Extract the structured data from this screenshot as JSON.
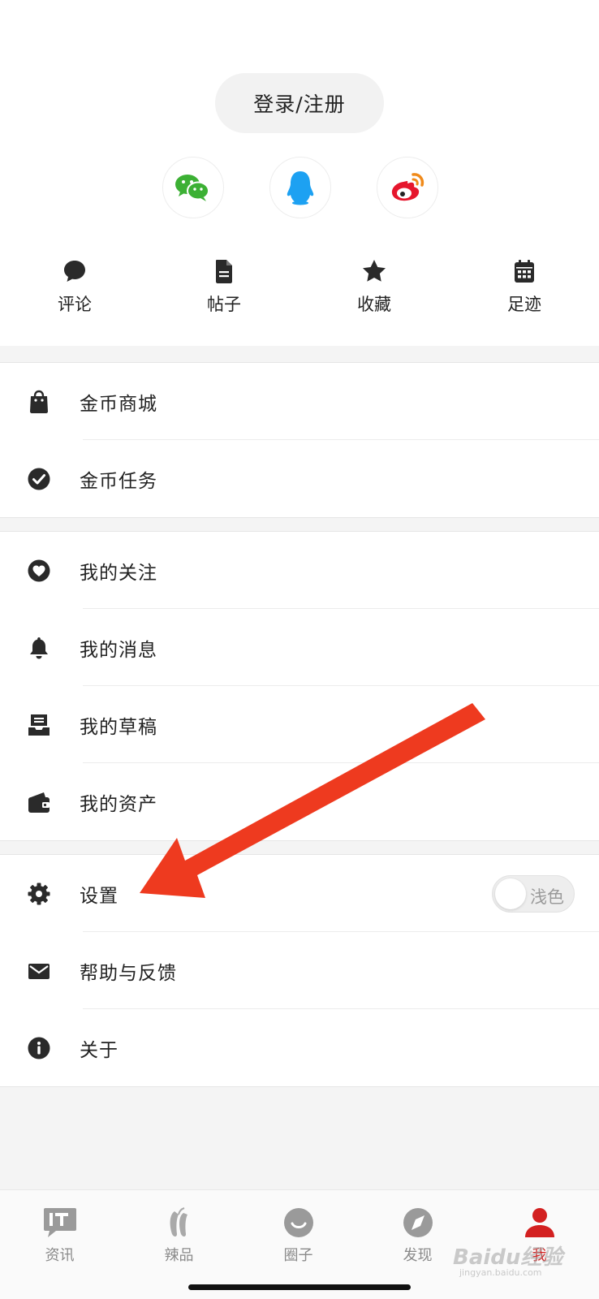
{
  "header": {
    "login_label": "登录/注册",
    "social": [
      {
        "icon": "wechat-icon",
        "color": "#3cb034"
      },
      {
        "icon": "qq-icon",
        "color": "#1da1f2"
      },
      {
        "icon": "weibo-icon",
        "color": "#e6162d"
      }
    ],
    "quick_links": [
      {
        "label": "评论",
        "icon": "comment-icon"
      },
      {
        "label": "帖子",
        "icon": "document-icon"
      },
      {
        "label": "收藏",
        "icon": "star-icon"
      },
      {
        "label": "足迹",
        "icon": "calendar-icon"
      }
    ]
  },
  "menu": {
    "coins": [
      {
        "label": "金币商城",
        "icon": "shopping-bag-icon"
      },
      {
        "label": "金币任务",
        "icon": "check-circle-icon"
      }
    ],
    "mine": [
      {
        "label": "我的关注",
        "icon": "heart-icon"
      },
      {
        "label": "我的消息",
        "icon": "bell-icon"
      },
      {
        "label": "我的草稿",
        "icon": "inbox-icon"
      },
      {
        "label": "我的资产",
        "icon": "wallet-icon"
      }
    ],
    "system": [
      {
        "label": "设置",
        "icon": "gear-icon"
      },
      {
        "label": "帮助与反馈",
        "icon": "mail-icon"
      },
      {
        "label": "关于",
        "icon": "info-icon"
      }
    ],
    "theme_toggle_label": "浅色",
    "theme_dark_enabled": false
  },
  "tabbar": {
    "tabs": [
      {
        "label": "资讯",
        "icon": "it-news-icon"
      },
      {
        "label": "辣品",
        "icon": "chili-icon"
      },
      {
        "label": "圈子",
        "icon": "circle-smile-icon"
      },
      {
        "label": "发现",
        "icon": "compass-icon"
      },
      {
        "label": "我",
        "icon": "user-icon"
      }
    ],
    "active": "我"
  },
  "colors": {
    "accent": "#d32020",
    "annotation_arrow": "#ee3a1f",
    "icon": "#2a2a2a",
    "tab_inactive": "#8a8a8a"
  },
  "watermark": {
    "text": "Baidu经验",
    "sub": "jingyan.baidu.com"
  }
}
